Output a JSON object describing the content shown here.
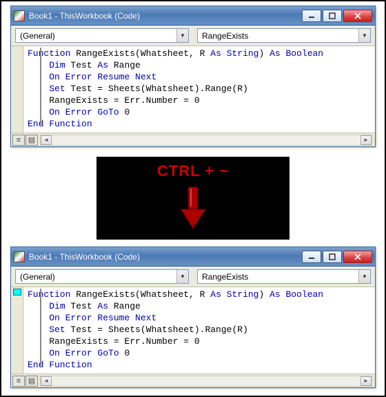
{
  "win1": {
    "title": "Book1 - ThisWorkbook (Code)",
    "obj": "(General)",
    "proc": "RangeExists",
    "breakpoint": false,
    "code": {
      "l1": {
        "a": "Function",
        "b": " RangeExists(Whatsheet, R ",
        "c": "As String",
        "d": ") ",
        "e": "As Boolean"
      },
      "l2": {
        "a": "Dim",
        "b": " Test ",
        "c": "As",
        "d": " Range"
      },
      "l3": {
        "a": "On Error Resume Next"
      },
      "l4": {
        "a": "Set",
        "b": " Test = Sheets(Whatsheet).Range(R)"
      },
      "l5": {
        "a": "RangeExists = Err.Number = 0"
      },
      "l6": {
        "a": "On Error GoTo",
        "b": " 0"
      },
      "l7": {
        "a": "End Function"
      }
    }
  },
  "shortcut": "CTRL + ~",
  "win2": {
    "title": "Book1 - ThisWorkbook (Code)",
    "obj": "(General)",
    "proc": "RangeExists",
    "breakpoint": true,
    "code": {
      "l1": {
        "a": "Function",
        "b": " RangeExists(Whatsheet, R ",
        "c": "As String",
        "d": ") ",
        "e": "As Boolean"
      },
      "l2": {
        "a": "Dim",
        "b": " Test ",
        "c": "As",
        "d": " Range"
      },
      "l3": {
        "a": "On Error Resume Next"
      },
      "l4": {
        "a": "Set",
        "b": " Test = Sheets(Whatsheet).Range(R)"
      },
      "l5": {
        "a": "RangeExists = Err.Number = 0"
      },
      "l6": {
        "a": "On Error GoTo",
        "b": " 0"
      },
      "l7": {
        "a": "End Function"
      }
    }
  }
}
